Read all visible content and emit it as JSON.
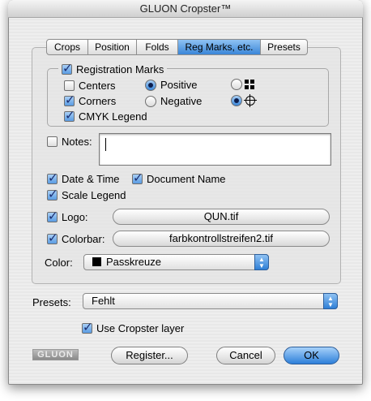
{
  "window": {
    "title": "GLUON Cropster™"
  },
  "tabs": [
    {
      "label": "Crops",
      "active": false
    },
    {
      "label": "Position",
      "active": false
    },
    {
      "label": "Folds",
      "active": false
    },
    {
      "label": "Reg Marks, etc.",
      "active": true
    },
    {
      "label": "Presets",
      "active": false
    }
  ],
  "registration": {
    "label": "Registration Marks",
    "checked": true,
    "centers": {
      "label": "Centers",
      "checked": false
    },
    "corners": {
      "label": "Corners",
      "checked": true
    },
    "cmyk_legend": {
      "label": "CMYK Legend",
      "checked": true
    },
    "positive": {
      "label": "Positive",
      "selected": true
    },
    "negative": {
      "label": "Negative",
      "selected": false
    },
    "mark_style_grid": {
      "icon": "grid-mark-icon",
      "selected": false
    },
    "mark_style_target": {
      "icon": "crosshair-mark-icon",
      "selected": true
    }
  },
  "notes": {
    "label": "Notes:",
    "checked": false,
    "value": ""
  },
  "date_time": {
    "label": "Date & Time",
    "checked": true
  },
  "document_name": {
    "label": "Document Name",
    "checked": true
  },
  "scale_legend": {
    "label": "Scale Legend",
    "checked": true
  },
  "logo": {
    "label": "Logo:",
    "checked": true,
    "file": "QUN.tif"
  },
  "colorbar": {
    "label": "Colorbar:",
    "checked": true,
    "file": "farbkontrollstreifen2.tif"
  },
  "color": {
    "label": "Color:",
    "value": "Passkreuze",
    "swatch": "#000000"
  },
  "presets": {
    "label": "Presets:",
    "value": "Fehlt"
  },
  "use_layer": {
    "label": "Use Cropster layer",
    "checked": true
  },
  "footer": {
    "brand": "GLUON",
    "register": "Register...",
    "cancel": "Cancel",
    "ok": "OK"
  },
  "colors": {
    "accent": "#3a86d8",
    "window_bg": "#ececec"
  }
}
